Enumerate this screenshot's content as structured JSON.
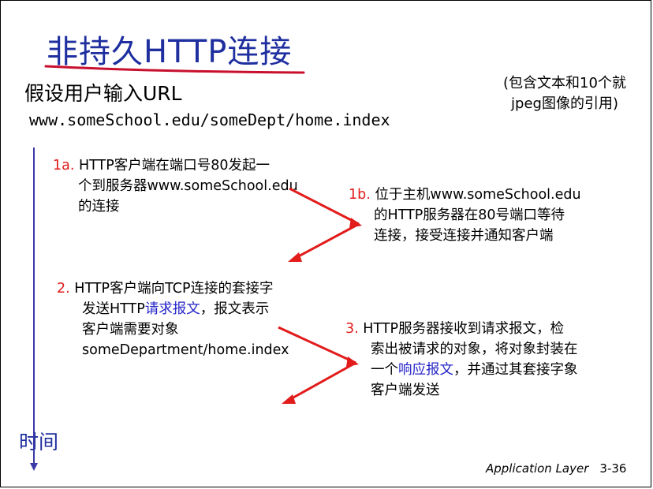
{
  "slide": {
    "title": "非持久HTTP连接",
    "subtitle": "假设用户输入URL",
    "url": "www.someSchool.edu/someDept/home.index",
    "note_line1": "(包含文本和10个就",
    "note_line2": "jpeg图像的引用)",
    "time_label": "时间",
    "footer_text": "Application Layer",
    "page_number": "3-36"
  },
  "steps": {
    "s1a": {
      "num": "1a.",
      "line1": "HTTP客户端在端口号80发起一",
      "line2": "个到服务器www.someSchool.edu",
      "line3": "的连接"
    },
    "s1b": {
      "num": "1b.",
      "line1": "位于主机www.someSchool.edu",
      "line2": "的HTTP服务器在80号端口等待",
      "line3": "连接，接受连接并通知客户端"
    },
    "s2": {
      "num": "2.",
      "line1": "HTTP客户端向TCP连接的套接字",
      "line2_pre": "发送HTTP",
      "line2_link": "请求报文",
      "line2_post": "，报文表示",
      "line3": "客户端需要对象",
      "line4": "someDepartment/home.index"
    },
    "s3": {
      "num": "3.",
      "line1": "HTTP服务器接收到请求报文，检",
      "line2": "索出被请求的对象，将对象封装在",
      "line3_pre": "一个",
      "line3_link": "响应报文",
      "line3_post": "，并通过其套接字象",
      "line4": "客户端发送"
    }
  },
  "colors": {
    "title": "#1f2f9f",
    "underline": "#c8102e",
    "arrow": "#e21b1b",
    "timeline": "#3a3aa8",
    "link": "#2424c8"
  }
}
